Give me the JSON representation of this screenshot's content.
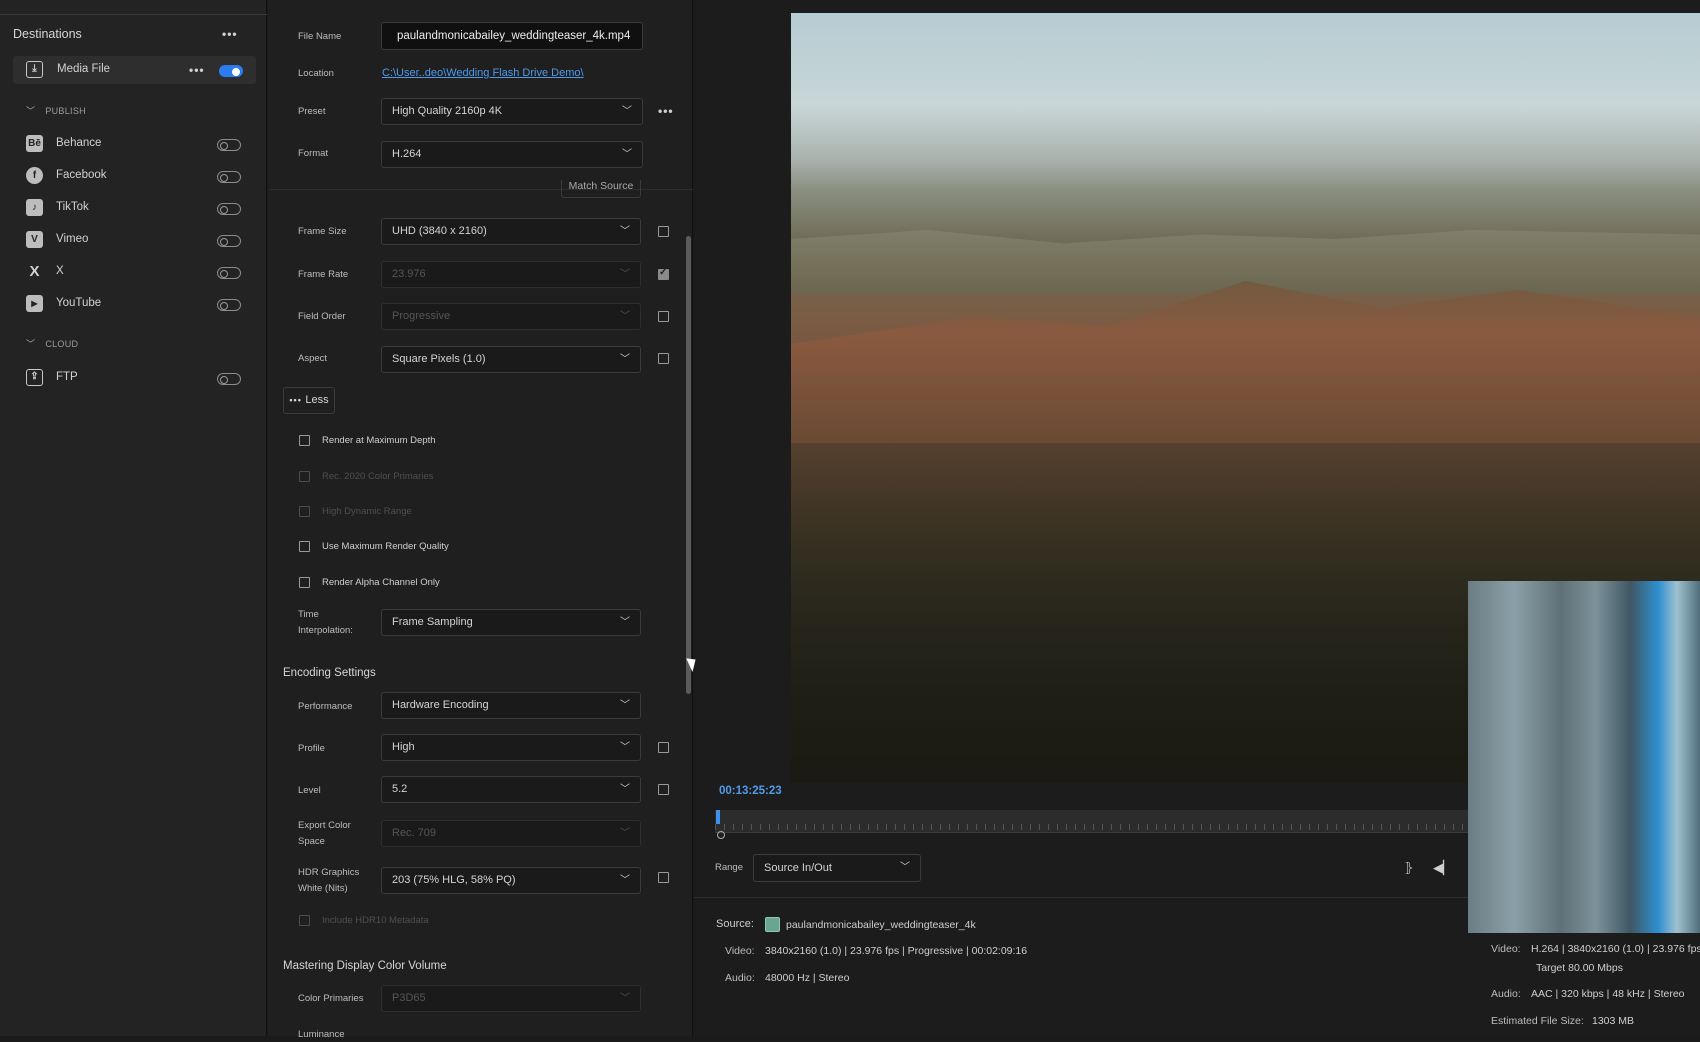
{
  "destinations": {
    "title": "Destinations",
    "media_file": {
      "label": "Media File",
      "enabled": true
    },
    "publish_label": "PUBLISH",
    "publish": [
      {
        "label": "Behance",
        "icon": "behance-icon",
        "glyph": "Bē"
      },
      {
        "label": "Facebook",
        "icon": "facebook-icon",
        "glyph": "f"
      },
      {
        "label": "TikTok",
        "icon": "tiktok-icon",
        "glyph": "♪"
      },
      {
        "label": "Vimeo",
        "icon": "vimeo-icon",
        "glyph": "V"
      },
      {
        "label": "X",
        "icon": "x-icon",
        "glyph": "X"
      },
      {
        "label": "YouTube",
        "icon": "youtube-icon",
        "glyph": "▶"
      }
    ],
    "cloud_label": "CLOUD",
    "cloud": [
      {
        "label": "FTP",
        "icon": "ftp-icon",
        "glyph": "⇪"
      }
    ]
  },
  "settings": {
    "file_name_label": "File Name",
    "file_name": "paulandmonicabailey_weddingteaser_4k.mp4",
    "location_label": "Location",
    "location": "C:\\User..deo\\Wedding Flash Drive Demo\\",
    "preset_label": "Preset",
    "preset": "High Quality 2160p 4K",
    "format_label": "Format",
    "format": "H.264",
    "match_source": "Match Source",
    "frame_size_label": "Frame Size",
    "frame_size": "UHD (3840 x 2160)",
    "frame_rate_label": "Frame Rate",
    "frame_rate": "23.976",
    "field_order_label": "Field Order",
    "field_order": "Progressive",
    "aspect_label": "Aspect",
    "aspect": "Square Pixels (1.0)",
    "less_label": "Less",
    "checkboxes": [
      {
        "label": "Render at Maximum Depth",
        "disabled": false
      },
      {
        "label": "Rec. 2020 Color Primaries",
        "disabled": true
      },
      {
        "label": "High Dynamic Range",
        "disabled": true
      },
      {
        "label": "Use Maximum Render Quality",
        "disabled": false
      },
      {
        "label": "Render Alpha Channel Only",
        "disabled": false
      }
    ],
    "time_interp_label1": "Time",
    "time_interp_label2": "Interpolation:",
    "time_interpolation": "Frame Sampling",
    "encoding_heading": "Encoding Settings",
    "performance_label": "Performance",
    "performance": "Hardware Encoding",
    "profile_label": "Profile",
    "profile": "High",
    "level_label": "Level",
    "level": "5.2",
    "export_cs_label1": "Export Color",
    "export_cs_label2": "Space",
    "export_color_space": "Rec. 709",
    "hdr_label1": "HDR Graphics",
    "hdr_label2": "White (Nits)",
    "hdr_white": "203 (75% HLG, 58% PQ)",
    "hdr10_label": "Include HDR10 Metadata",
    "mastering_heading": "Mastering Display Color Volume",
    "color_primaries_label": "Color Primaries",
    "color_primaries": "P3D65",
    "luminance_label": "Luminance"
  },
  "preview": {
    "timecode": "00:13:25:23",
    "range_label": "Range",
    "range_value": "Source In/Out"
  },
  "source": {
    "label": "Source:",
    "name": "paulandmonicabailey_weddingteaser_4k",
    "video_label": "Video:",
    "video": "3840x2160 (1.0)  |  23.976 fps  |  Progressive  |  00:02:09:16",
    "audio_label": "Audio:",
    "audio": "48000 Hz  |  Stereo"
  },
  "output": {
    "video_label": "Video:",
    "video": "H.264  |  3840x2160 (1.0)  |  23.976 fps",
    "target": "Target 80.00 Mbps",
    "audio_label": "Audio:",
    "audio": "AAC  |  320 kbps  |  48 kHz  |  Stereo",
    "size_label": "Estimated File Size:",
    "size": "1303 MB"
  }
}
